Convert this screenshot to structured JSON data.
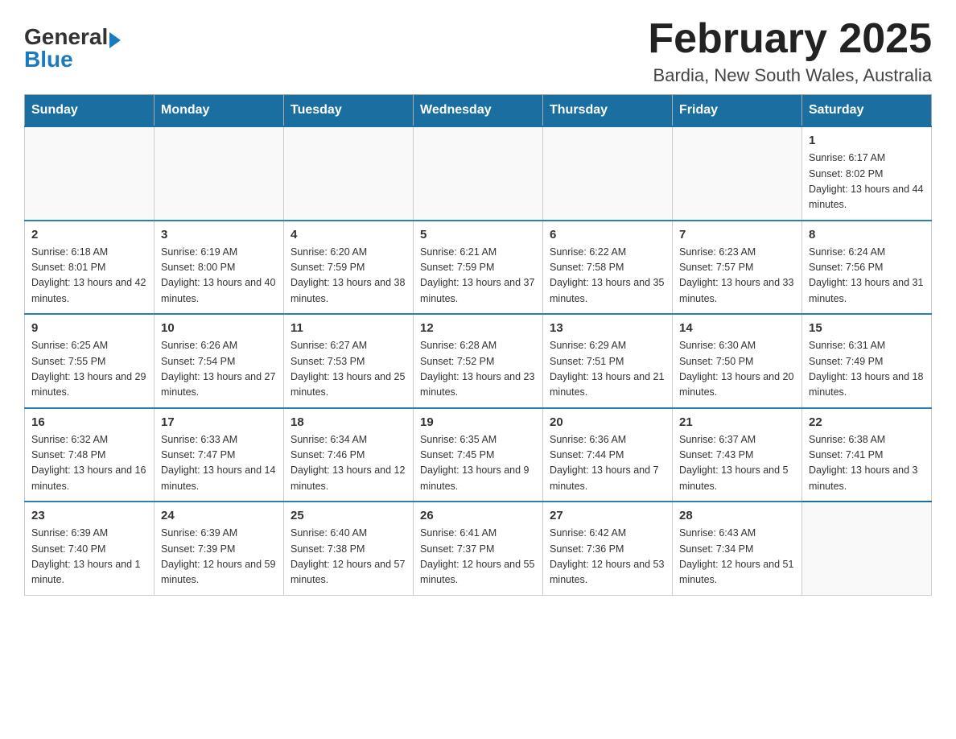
{
  "header": {
    "logo": {
      "line1": "General",
      "arrow": true,
      "line2": "Blue"
    },
    "title": "February 2025",
    "location": "Bardia, New South Wales, Australia"
  },
  "weekdays": [
    "Sunday",
    "Monday",
    "Tuesday",
    "Wednesday",
    "Thursday",
    "Friday",
    "Saturday"
  ],
  "weeks": [
    [
      {
        "day": "",
        "info": ""
      },
      {
        "day": "",
        "info": ""
      },
      {
        "day": "",
        "info": ""
      },
      {
        "day": "",
        "info": ""
      },
      {
        "day": "",
        "info": ""
      },
      {
        "day": "",
        "info": ""
      },
      {
        "day": "1",
        "info": "Sunrise: 6:17 AM\nSunset: 8:02 PM\nDaylight: 13 hours and 44 minutes."
      }
    ],
    [
      {
        "day": "2",
        "info": "Sunrise: 6:18 AM\nSunset: 8:01 PM\nDaylight: 13 hours and 42 minutes."
      },
      {
        "day": "3",
        "info": "Sunrise: 6:19 AM\nSunset: 8:00 PM\nDaylight: 13 hours and 40 minutes."
      },
      {
        "day": "4",
        "info": "Sunrise: 6:20 AM\nSunset: 7:59 PM\nDaylight: 13 hours and 38 minutes."
      },
      {
        "day": "5",
        "info": "Sunrise: 6:21 AM\nSunset: 7:59 PM\nDaylight: 13 hours and 37 minutes."
      },
      {
        "day": "6",
        "info": "Sunrise: 6:22 AM\nSunset: 7:58 PM\nDaylight: 13 hours and 35 minutes."
      },
      {
        "day": "7",
        "info": "Sunrise: 6:23 AM\nSunset: 7:57 PM\nDaylight: 13 hours and 33 minutes."
      },
      {
        "day": "8",
        "info": "Sunrise: 6:24 AM\nSunset: 7:56 PM\nDaylight: 13 hours and 31 minutes."
      }
    ],
    [
      {
        "day": "9",
        "info": "Sunrise: 6:25 AM\nSunset: 7:55 PM\nDaylight: 13 hours and 29 minutes."
      },
      {
        "day": "10",
        "info": "Sunrise: 6:26 AM\nSunset: 7:54 PM\nDaylight: 13 hours and 27 minutes."
      },
      {
        "day": "11",
        "info": "Sunrise: 6:27 AM\nSunset: 7:53 PM\nDaylight: 13 hours and 25 minutes."
      },
      {
        "day": "12",
        "info": "Sunrise: 6:28 AM\nSunset: 7:52 PM\nDaylight: 13 hours and 23 minutes."
      },
      {
        "day": "13",
        "info": "Sunrise: 6:29 AM\nSunset: 7:51 PM\nDaylight: 13 hours and 21 minutes."
      },
      {
        "day": "14",
        "info": "Sunrise: 6:30 AM\nSunset: 7:50 PM\nDaylight: 13 hours and 20 minutes."
      },
      {
        "day": "15",
        "info": "Sunrise: 6:31 AM\nSunset: 7:49 PM\nDaylight: 13 hours and 18 minutes."
      }
    ],
    [
      {
        "day": "16",
        "info": "Sunrise: 6:32 AM\nSunset: 7:48 PM\nDaylight: 13 hours and 16 minutes."
      },
      {
        "day": "17",
        "info": "Sunrise: 6:33 AM\nSunset: 7:47 PM\nDaylight: 13 hours and 14 minutes."
      },
      {
        "day": "18",
        "info": "Sunrise: 6:34 AM\nSunset: 7:46 PM\nDaylight: 13 hours and 12 minutes."
      },
      {
        "day": "19",
        "info": "Sunrise: 6:35 AM\nSunset: 7:45 PM\nDaylight: 13 hours and 9 minutes."
      },
      {
        "day": "20",
        "info": "Sunrise: 6:36 AM\nSunset: 7:44 PM\nDaylight: 13 hours and 7 minutes."
      },
      {
        "day": "21",
        "info": "Sunrise: 6:37 AM\nSunset: 7:43 PM\nDaylight: 13 hours and 5 minutes."
      },
      {
        "day": "22",
        "info": "Sunrise: 6:38 AM\nSunset: 7:41 PM\nDaylight: 13 hours and 3 minutes."
      }
    ],
    [
      {
        "day": "23",
        "info": "Sunrise: 6:39 AM\nSunset: 7:40 PM\nDaylight: 13 hours and 1 minute."
      },
      {
        "day": "24",
        "info": "Sunrise: 6:39 AM\nSunset: 7:39 PM\nDaylight: 12 hours and 59 minutes."
      },
      {
        "day": "25",
        "info": "Sunrise: 6:40 AM\nSunset: 7:38 PM\nDaylight: 12 hours and 57 minutes."
      },
      {
        "day": "26",
        "info": "Sunrise: 6:41 AM\nSunset: 7:37 PM\nDaylight: 12 hours and 55 minutes."
      },
      {
        "day": "27",
        "info": "Sunrise: 6:42 AM\nSunset: 7:36 PM\nDaylight: 12 hours and 53 minutes."
      },
      {
        "day": "28",
        "info": "Sunrise: 6:43 AM\nSunset: 7:34 PM\nDaylight: 12 hours and 51 minutes."
      },
      {
        "day": "",
        "info": ""
      }
    ]
  ]
}
